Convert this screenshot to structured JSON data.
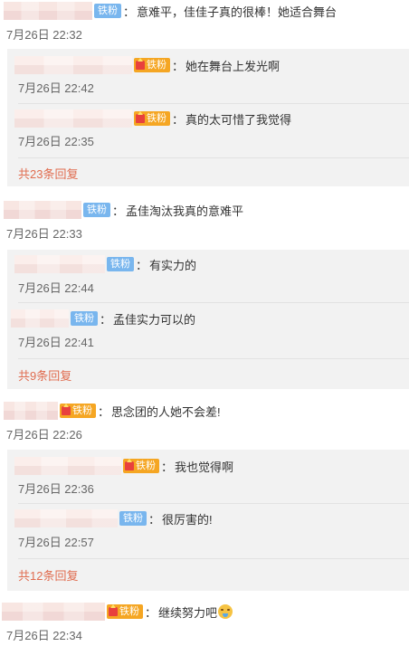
{
  "colors": {
    "fan_badge_blue": "#79b6ee",
    "fan_badge_gold": "#f5a623",
    "more_link": "#e06c4f",
    "reply_background": "#f2f2f2"
  },
  "comments": [
    {
      "badge": "铁粉",
      "text": "意难平，佳佳子真的很棒！她适合舞台",
      "time": "7月26日 22:32",
      "replies": [
        {
          "badge": "铁粉",
          "text": "她在舞台上发光啊",
          "time": "7月26日 22:42"
        },
        {
          "badge": "铁粉",
          "text": "真的太可惜了我觉得",
          "time": "7月26日 22:35"
        }
      ],
      "more": "共23条回复"
    },
    {
      "badge": "铁粉",
      "text": "孟佳淘汰我真的意难平",
      "time": "7月26日 22:33",
      "replies": [
        {
          "badge": "铁粉",
          "text": "有实力的",
          "time": "7月26日 22:44"
        },
        {
          "badge": "铁粉",
          "text": "孟佳实力可以的",
          "time": "7月26日 22:41"
        }
      ],
      "more": "共9条回复"
    },
    {
      "badge": "铁粉",
      "text": "思念团的人她不会差!",
      "time": "7月26日 22:26",
      "replies": [
        {
          "badge": "铁粉",
          "text": "我也觉得啊",
          "time": "7月26日 22:36"
        },
        {
          "badge": "铁粉",
          "text": "很厉害的!",
          "time": "7月26日 22:57"
        }
      ],
      "more": "共12条回复"
    },
    {
      "badge": "铁粉",
      "text": "继续努力吧",
      "emoji": "crying-face-icon",
      "time": "7月26日 22:34"
    }
  ],
  "colon": "："
}
